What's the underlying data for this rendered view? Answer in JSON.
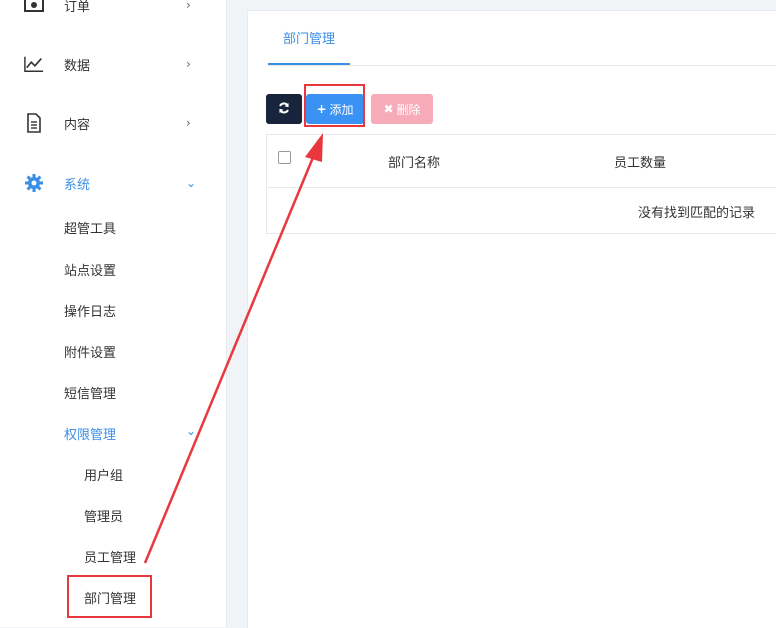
{
  "sidebar": {
    "menu": [
      {
        "label": "订单",
        "icon": "money-icon"
      },
      {
        "label": "数据",
        "icon": "line-chart-icon"
      },
      {
        "label": "内容",
        "icon": "document-icon"
      },
      {
        "label": "系统",
        "icon": "gear-icon"
      }
    ],
    "system_items": [
      "超管工具",
      "站点设置",
      "操作日志",
      "附件设置",
      "短信管理",
      "权限管理"
    ],
    "permission_items": [
      "用户组",
      "管理员",
      "员工管理",
      "部门管理"
    ]
  },
  "main": {
    "tab": "部门管理",
    "toolbar": {
      "add": "添加",
      "delete": "删除"
    },
    "table": {
      "headers": [
        "部门名称",
        "员工数量"
      ],
      "empty_text": "没有找到匹配的记录"
    }
  },
  "colors": {
    "accent": "#3a8ee6",
    "dark_button": "#17243b",
    "add_button": "#3a93f4",
    "delete_button": "#f7aab8",
    "annotation": "#e8383d"
  }
}
